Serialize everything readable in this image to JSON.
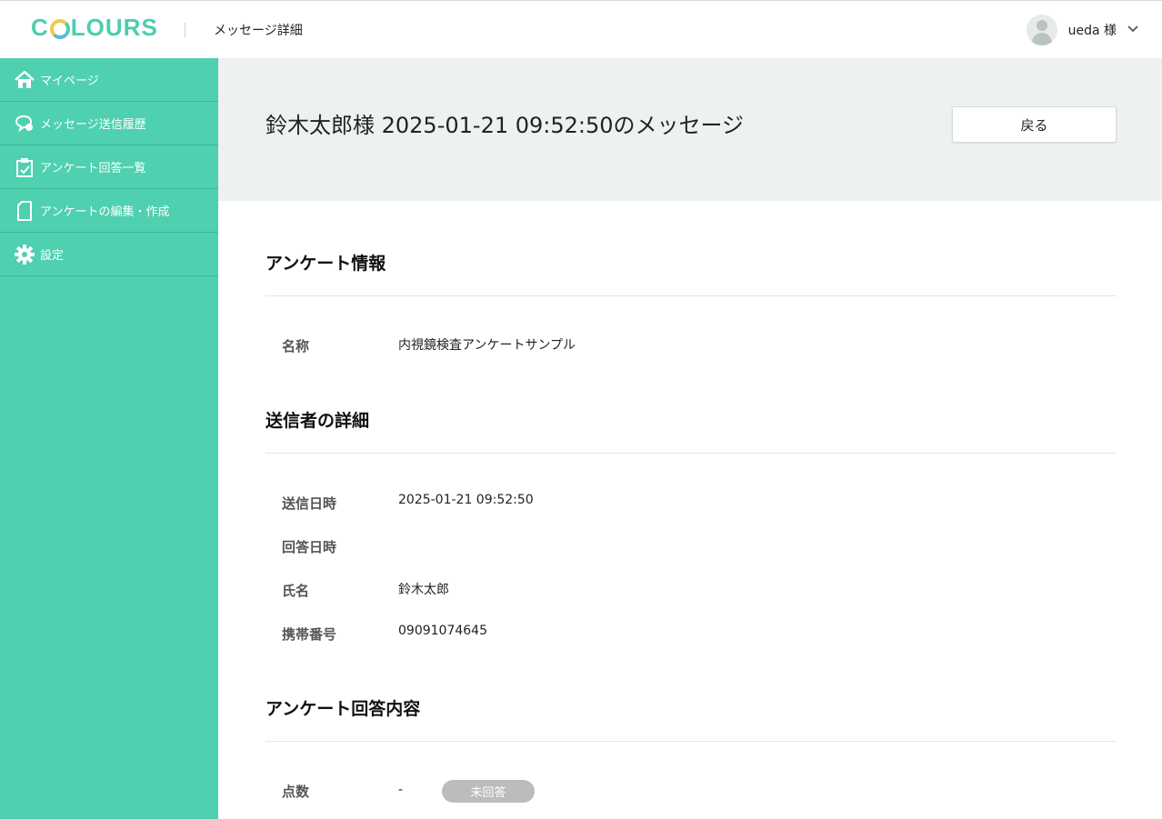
{
  "header": {
    "logo_text": "COLOURS",
    "page_title": "メッセージ詳細",
    "user_name": "ueda 様"
  },
  "sidebar": {
    "items": [
      {
        "label": "マイページ",
        "icon": "home-icon"
      },
      {
        "label": "メッセージ送信履歴",
        "icon": "chat-icon"
      },
      {
        "label": "アンケート回答一覧",
        "icon": "clipboard-icon"
      },
      {
        "label": "アンケートの編集・作成",
        "icon": "document-icon"
      },
      {
        "label": "設定",
        "icon": "gear-icon"
      }
    ]
  },
  "hero": {
    "title": "鈴木太郎様 2025-01-21 09:52:50のメッセージ",
    "back_label": "戻る"
  },
  "survey_info": {
    "heading": "アンケート情報",
    "name_label": "名称",
    "name_value": "内視鏡検査アンケートサンプル"
  },
  "sender": {
    "heading": "送信者の詳細",
    "sent_label": "送信日時",
    "sent_value": "2025-01-21 09:52:50",
    "answered_label": "回答日時",
    "answered_value": "",
    "name_label": "氏名",
    "name_value": "鈴木太郎",
    "phone_label": "携帯番号",
    "phone_value": "09091074645"
  },
  "answers": {
    "heading": "アンケート回答内容",
    "score_label": "点数",
    "score_value": "-",
    "status_badge": "未回答"
  },
  "colors": {
    "brand": "#4fd0b0",
    "hero_bg": "#edf1f1",
    "badge": "#bcbcbc"
  }
}
